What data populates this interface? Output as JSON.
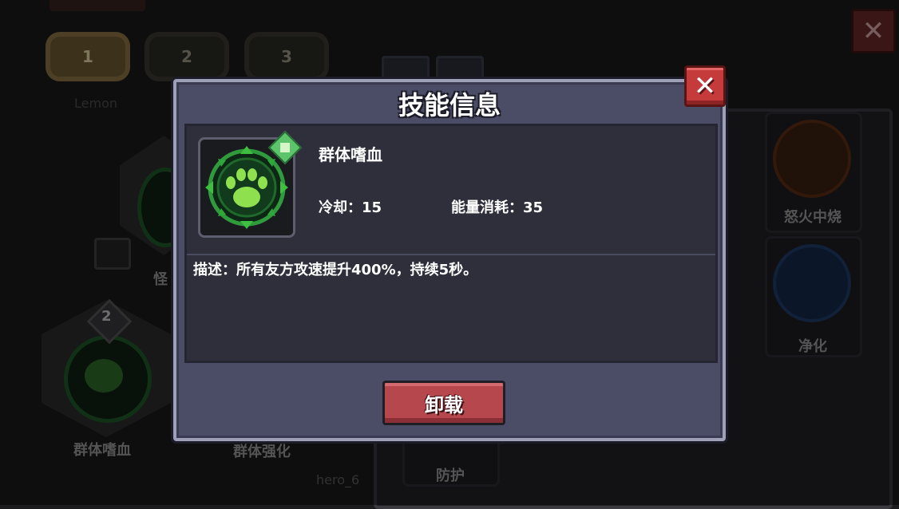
{
  "background": {
    "slot_tabs": [
      "1",
      "2",
      "3"
    ],
    "player_name": "Lemon",
    "left_skill_labels": [
      "怪",
      "群体嗜血",
      "群体强化"
    ],
    "slot_badge_number": "2",
    "hero_label": "hero_6",
    "right_card_labels": [
      "怒火中烧",
      "净化",
      "防护"
    ]
  },
  "dialog": {
    "title": "技能信息",
    "close_label": "✕",
    "skill": {
      "name": "群体嗜血",
      "cooldown": "冷却：15",
      "energy_cost": "能量消耗：35",
      "description": "描述：所有友方攻速提升400%，持续5秒。"
    },
    "unequip_label": "卸载"
  },
  "colors": {
    "dialog_bg": "#4b4c65",
    "panel_bg": "#2f2f3c",
    "close_red": "#c53a3a",
    "unequip_red": "#b5474d",
    "skill_green": "#3fbf3f"
  }
}
